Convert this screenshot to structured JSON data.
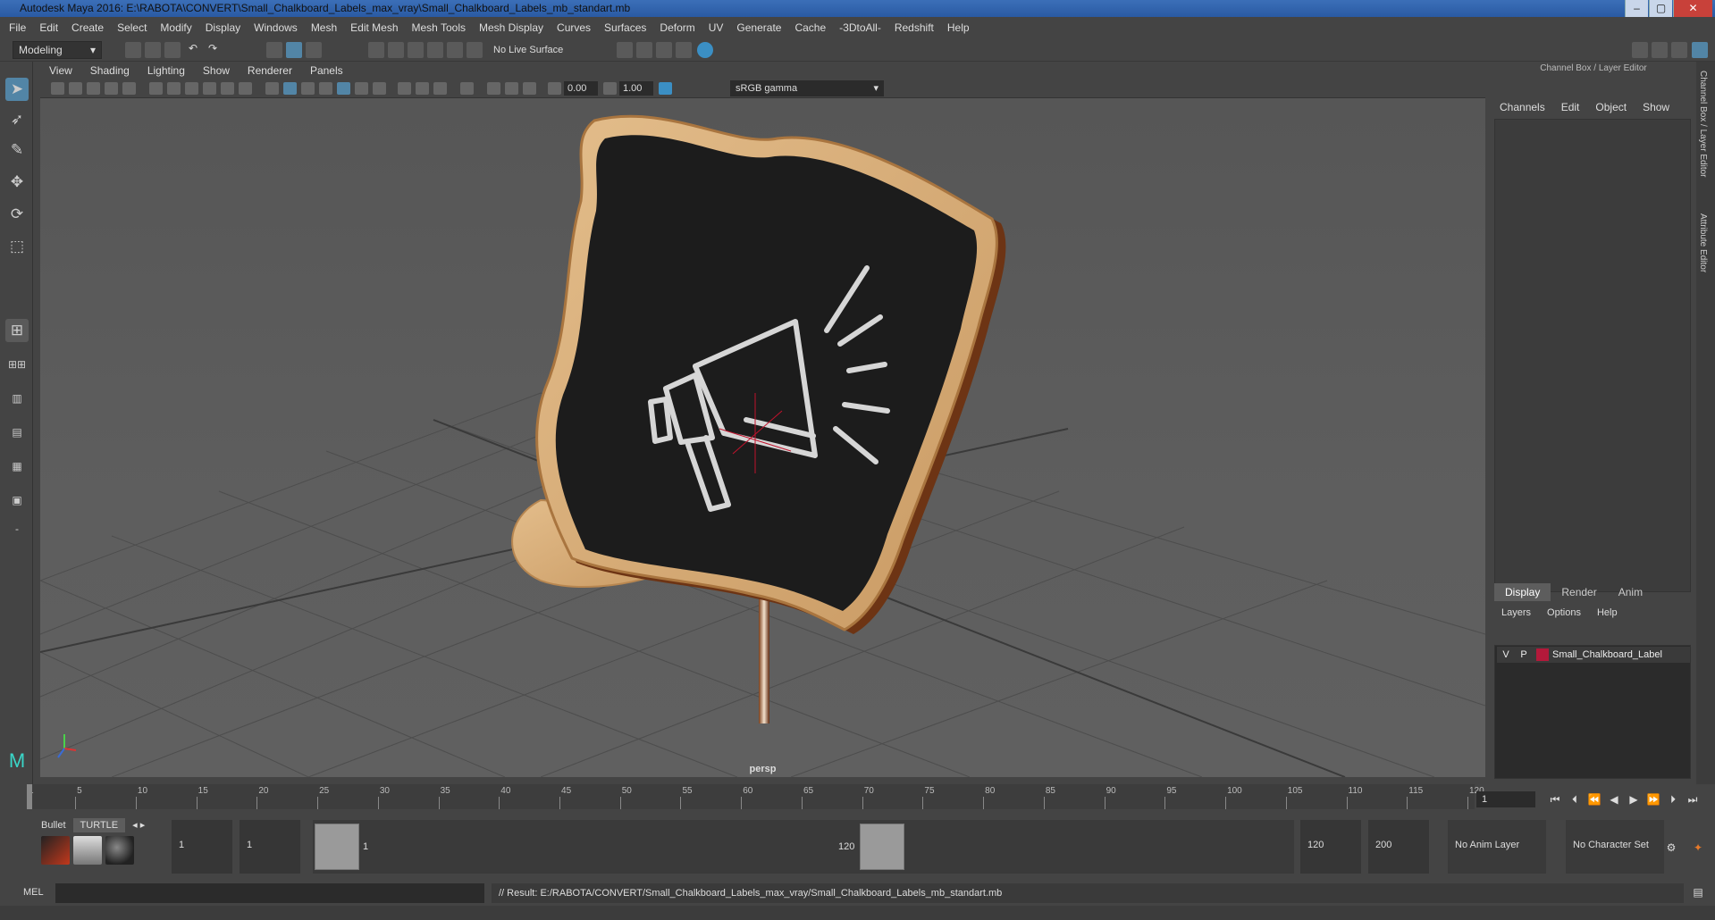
{
  "window": {
    "title": "Autodesk Maya 2016: E:\\RABOTA\\CONVERT\\Small_Chalkboard_Labels_max_vray\\Small_Chalkboard_Labels_mb_standart.mb",
    "minimize": "–",
    "maximize": "▢",
    "close": "✕"
  },
  "menubar": [
    "File",
    "Edit",
    "Create",
    "Select",
    "Modify",
    "Display",
    "Windows",
    "Mesh",
    "Edit Mesh",
    "Mesh Tools",
    "Mesh Display",
    "Curves",
    "Surfaces",
    "Deform",
    "UV",
    "Generate",
    "Cache",
    "-3DtoAll-",
    "Redshift",
    "Help"
  ],
  "statusline": {
    "mode": "Modeling",
    "live_surface": "No Live Surface"
  },
  "viewport": {
    "menu": [
      "View",
      "Shading",
      "Lighting",
      "Show",
      "Renderer",
      "Panels"
    ],
    "exposure": "0.00",
    "gamma_value": "1.00",
    "color_space": "sRGB gamma",
    "camera_label": "persp"
  },
  "channel_box": {
    "title": "Channel Box / Layer Editor",
    "menu": [
      "Channels",
      "Edit",
      "Object",
      "Show"
    ],
    "tabs": [
      "Display",
      "Render",
      "Anim"
    ],
    "layer_menu": [
      "Layers",
      "Options",
      "Help"
    ],
    "layer": {
      "visible": "V",
      "playback": "P",
      "name": "Small_Chalkboard_Label",
      "color": "#b3193a"
    },
    "side_tabs": [
      "Channel Box / Layer Editor",
      "Attribute Editor"
    ]
  },
  "timeline": {
    "ticks": [
      "1",
      "5",
      "10",
      "15",
      "20",
      "25",
      "30",
      "35",
      "40",
      "45",
      "50",
      "55",
      "60",
      "65",
      "70",
      "75",
      "80",
      "85",
      "90",
      "95",
      "100",
      "105",
      "110",
      "115",
      "120"
    ],
    "current_frame": "1"
  },
  "range": {
    "shelf_tabs": [
      "Bullet",
      "TURTLE"
    ],
    "start_time": "1",
    "playback_start": "1",
    "range_start_label": "1",
    "range_end_label": "120",
    "playback_end": "120",
    "end_time": "200",
    "anim_layer": "No Anim Layer",
    "character_set": "No Character Set"
  },
  "commandline": {
    "language": "MEL",
    "result": "// Result: E:/RABOTA/CONVERT/Small_Chalkboard_Labels_max_vray/Small_Chalkboard_Labels_mb_standart.mb"
  }
}
